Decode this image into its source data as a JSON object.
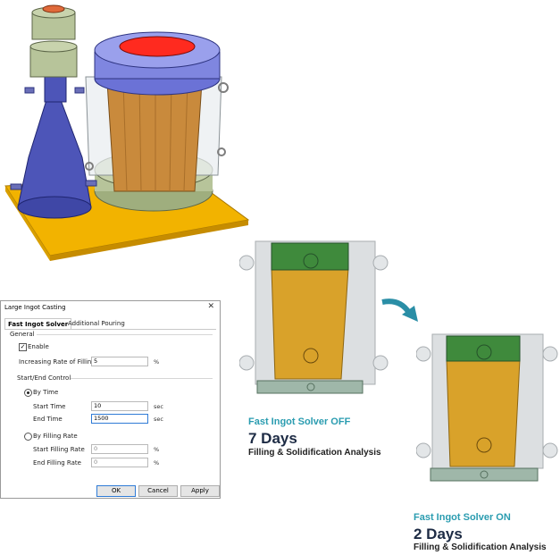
{
  "dialog": {
    "title": "Large Ingot Casting",
    "close_glyph": "✕",
    "tabs": [
      {
        "label": "Fast Ingot Solver",
        "active": true
      },
      {
        "label": "Additional Pouring",
        "active": false
      }
    ],
    "general": {
      "group_label": "General",
      "enable_label": "Enable",
      "enable_checked": true,
      "rate_label": "Increasing Rate of Filling",
      "rate_value": "5",
      "rate_unit": "%"
    },
    "start_end": {
      "group_label": "Start/End Control",
      "by_time_label": "By Time",
      "by_time_selected": true,
      "start_time_label": "Start Time",
      "start_time_value": "10",
      "start_time_unit": "sec",
      "end_time_label": "End Time",
      "end_time_value": "1500",
      "end_time_unit": "sec",
      "by_rate_label": "By Filling Rate",
      "start_rate_label": "Start Filling Rate",
      "start_rate_value": "0",
      "start_rate_unit": "%",
      "end_rate_label": "End Filling Rate",
      "end_rate_value": "0",
      "end_rate_unit": "%"
    },
    "buttons": {
      "ok": "OK",
      "cancel": "Cancel",
      "apply": "Apply"
    }
  },
  "captions": {
    "off": {
      "title": "Fast Ingot Solver OFF",
      "days": "7 Days",
      "subtitle": "Filling & Solidification Analysis"
    },
    "on": {
      "title": "Fast Ingot Solver ON",
      "days": "2 Days",
      "subtitle": "Filling & Solidification Analysis"
    }
  },
  "colors": {
    "accent": "#2a9cb0",
    "ingot": "#d9a22a",
    "riser": "#3f8a3c",
    "mold": "#c9c9c9",
    "base": "#f2b300",
    "funnel": "#4d55b8",
    "hot_metal": "#ff2a1f"
  }
}
